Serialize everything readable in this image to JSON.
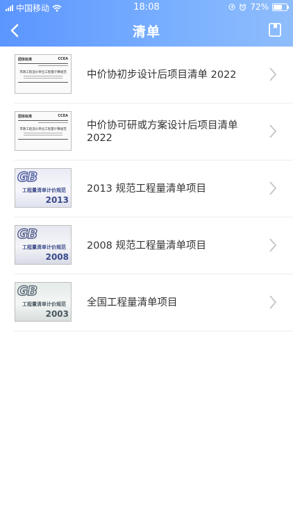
{
  "status_bar": {
    "carrier": "中国移动",
    "time": "18:08",
    "battery": "72%",
    "battery_level": 0.72
  },
  "nav": {
    "title": "清单"
  },
  "items": [
    {
      "label": "中价协初步设计后项目清单 2022",
      "thumb": {
        "type": "doc",
        "org": "团体标准",
        "brand": "CCEA",
        "title": "市政工程造价单位工程量计算规范"
      }
    },
    {
      "label": "中价协可研或方案设计后项目清单 2022",
      "thumb": {
        "type": "doc",
        "org": "团体标准",
        "brand": "CCEA",
        "title": "市政工程造价单位工程量计算规范"
      }
    },
    {
      "label": "2013 规范工程量清单项目",
      "thumb": {
        "type": "gb",
        "mark": "GB",
        "name": "工程量清单计价规范",
        "year": "2013"
      }
    },
    {
      "label": "2008 规范工程量清单项目",
      "thumb": {
        "type": "gb",
        "mark": "GB",
        "name": "工程量清单计价规范",
        "year": "2008"
      }
    },
    {
      "label": "全国工程量清单项目",
      "thumb": {
        "type": "gb",
        "mark": "GB",
        "name": "工程量清单计价规范",
        "year": "2003"
      }
    }
  ],
  "colors": {
    "header_start": "#5b95ff",
    "header_end": "#8fbdfc",
    "text": "#333333",
    "divider": "#ececec"
  }
}
